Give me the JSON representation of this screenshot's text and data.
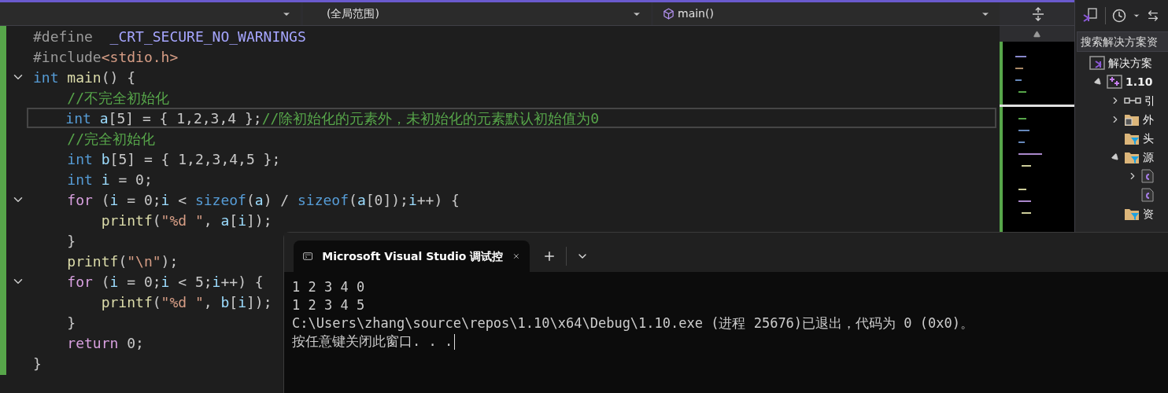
{
  "nav_bar": {
    "scope_dropdown": {
      "value": "(全局范围)"
    },
    "member_dropdown": {
      "value": "main()"
    }
  },
  "code_lines": [
    {
      "fold": false,
      "current": false,
      "tokens": [
        {
          "kind": "pp",
          "text": "#define  "
        },
        {
          "kind": "macro",
          "text": "_CRT_SECURE_NO_WARNINGS"
        }
      ]
    },
    {
      "fold": false,
      "current": false,
      "tokens": [
        {
          "kind": "pp",
          "text": "#include"
        },
        {
          "kind": "str",
          "text": "<stdio.h>"
        }
      ]
    },
    {
      "fold": true,
      "current": false,
      "tokens": [
        {
          "kind": "kw",
          "text": "int "
        },
        {
          "kind": "fn",
          "text": "main"
        },
        {
          "kind": "punc",
          "text": "() {"
        }
      ]
    },
    {
      "fold": false,
      "current": false,
      "tokens": [
        {
          "kind": "comment",
          "text": "    //不完全初始化"
        }
      ]
    },
    {
      "fold": false,
      "current": true,
      "tokens": [
        {
          "kind": "kw",
          "text": "    int "
        },
        {
          "kind": "var",
          "text": "a"
        },
        {
          "kind": "punc",
          "text": "[5] = { 1,2,3,4 };"
        },
        {
          "kind": "comment",
          "text": "//除初始化的元素外，未初始化的元素默认初始值为0"
        }
      ]
    },
    {
      "fold": false,
      "current": false,
      "tokens": [
        {
          "kind": "comment",
          "text": "    //完全初始化"
        }
      ]
    },
    {
      "fold": false,
      "current": false,
      "tokens": [
        {
          "kind": "kw",
          "text": "    int "
        },
        {
          "kind": "var",
          "text": "b"
        },
        {
          "kind": "punc",
          "text": "[5] = { 1,2,3,4,5 };"
        }
      ]
    },
    {
      "fold": false,
      "current": false,
      "tokens": [
        {
          "kind": "kw",
          "text": "    int "
        },
        {
          "kind": "var",
          "text": "i"
        },
        {
          "kind": "punc",
          "text": " = 0;"
        }
      ]
    },
    {
      "fold": true,
      "current": false,
      "tokens": [
        {
          "kind": "ctrl",
          "text": "    for"
        },
        {
          "kind": "punc",
          "text": " ("
        },
        {
          "kind": "var",
          "text": "i"
        },
        {
          "kind": "punc",
          "text": " = 0;"
        },
        {
          "kind": "var",
          "text": "i"
        },
        {
          "kind": "punc",
          "text": " < "
        },
        {
          "kind": "kw",
          "text": "sizeof"
        },
        {
          "kind": "punc",
          "text": "("
        },
        {
          "kind": "var",
          "text": "a"
        },
        {
          "kind": "punc",
          "text": ") / "
        },
        {
          "kind": "kw",
          "text": "sizeof"
        },
        {
          "kind": "punc",
          "text": "("
        },
        {
          "kind": "var",
          "text": "a"
        },
        {
          "kind": "punc",
          "text": "[0]);"
        },
        {
          "kind": "var",
          "text": "i"
        },
        {
          "kind": "punc",
          "text": "++) {"
        }
      ]
    },
    {
      "fold": false,
      "current": false,
      "tokens": [
        {
          "kind": "fn",
          "text": "        printf"
        },
        {
          "kind": "punc",
          "text": "("
        },
        {
          "kind": "str",
          "text": "\"%d \""
        },
        {
          "kind": "punc",
          "text": ", "
        },
        {
          "kind": "var",
          "text": "a"
        },
        {
          "kind": "punc",
          "text": "["
        },
        {
          "kind": "var",
          "text": "i"
        },
        {
          "kind": "punc",
          "text": "]);"
        }
      ]
    },
    {
      "fold": false,
      "current": false,
      "tokens": [
        {
          "kind": "punc",
          "text": "    }"
        }
      ]
    },
    {
      "fold": false,
      "current": false,
      "tokens": [
        {
          "kind": "fn",
          "text": "    printf"
        },
        {
          "kind": "punc",
          "text": "("
        },
        {
          "kind": "str",
          "text": "\"\\n\""
        },
        {
          "kind": "punc",
          "text": ");"
        }
      ]
    },
    {
      "fold": true,
      "current": false,
      "tokens": [
        {
          "kind": "ctrl",
          "text": "    for"
        },
        {
          "kind": "punc",
          "text": " ("
        },
        {
          "kind": "var",
          "text": "i"
        },
        {
          "kind": "punc",
          "text": " = 0;"
        },
        {
          "kind": "var",
          "text": "i"
        },
        {
          "kind": "punc",
          "text": " < 5;"
        },
        {
          "kind": "var",
          "text": "i"
        },
        {
          "kind": "punc",
          "text": "++) {"
        }
      ]
    },
    {
      "fold": false,
      "current": false,
      "tokens": [
        {
          "kind": "fn",
          "text": "        printf"
        },
        {
          "kind": "punc",
          "text": "("
        },
        {
          "kind": "str",
          "text": "\"%d \""
        },
        {
          "kind": "punc",
          "text": ", "
        },
        {
          "kind": "var",
          "text": "b"
        },
        {
          "kind": "punc",
          "text": "["
        },
        {
          "kind": "var",
          "text": "i"
        },
        {
          "kind": "punc",
          "text": "]);"
        }
      ]
    },
    {
      "fold": false,
      "current": false,
      "tokens": [
        {
          "kind": "punc",
          "text": "    }"
        }
      ]
    },
    {
      "fold": false,
      "current": false,
      "tokens": [
        {
          "kind": "ctrl",
          "text": "    return"
        },
        {
          "kind": "punc",
          "text": " 0;"
        }
      ]
    },
    {
      "fold": false,
      "current": false,
      "tokens": [
        {
          "kind": "punc",
          "text": "}"
        }
      ]
    }
  ],
  "solution_explorer": {
    "search": {
      "placeholder": "搜索解决方案资"
    },
    "tree": [
      {
        "label": "解决方案",
        "kind": "solution",
        "children": [
          {
            "label": "1.10",
            "kind": "project",
            "expanded": true,
            "children": [
              {
                "label": "引",
                "kind": "references",
                "expanded": false
              },
              {
                "label": "外",
                "kind": "external",
                "expanded": false
              },
              {
                "label": "头",
                "kind": "filter"
              },
              {
                "label": "源",
                "kind": "filter",
                "expanded": true,
                "children": [
                  {
                    "kind": "cfile",
                    "expanded": false
                  },
                  {
                    "kind": "cfile"
                  }
                ]
              },
              {
                "label": "资",
                "kind": "filter"
              }
            ]
          }
        ]
      }
    ]
  },
  "terminal": {
    "tab_title": "Microsoft Visual Studio 调试控",
    "output": [
      "1 2 3 4 0",
      "1 2 3 4 5",
      "C:\\Users\\zhang\\source\\repos\\1.10\\x64\\Debug\\1.10.exe (进程 25676)已退出，代码为 0 (0x0)。",
      "按任意键关闭此窗口. . ."
    ]
  }
}
